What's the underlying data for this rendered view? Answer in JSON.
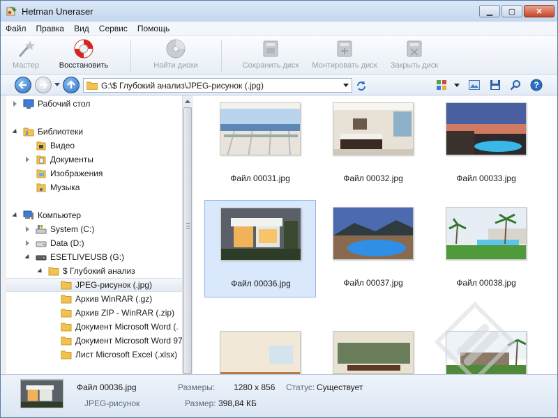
{
  "window": {
    "title": "Hetman Uneraser"
  },
  "menu": [
    "Файл",
    "Правка",
    "Вид",
    "Сервис",
    "Помощь"
  ],
  "toolbar": {
    "wizard": "Мастер",
    "restore": "Восстановить",
    "find_disks": "Найти диски",
    "save_disk": "Сохранить диск",
    "mount_disk": "Монтировать диск",
    "close_disk": "Закрыть диск"
  },
  "address": {
    "path": "G:\\$ Глубокий анализ\\JPEG-рисунок (.jpg)"
  },
  "tree": [
    {
      "label": "Рабочий стол",
      "icon": "desktop-icon"
    },
    {
      "label": "Библиотеки",
      "icon": "libraries-icon"
    },
    {
      "label": "Видео",
      "icon": "video-library-icon"
    },
    {
      "label": "Документы",
      "icon": "documents-library-icon"
    },
    {
      "label": "Изображения",
      "icon": "pictures-library-icon"
    },
    {
      "label": "Музыка",
      "icon": "music-library-icon"
    },
    {
      "label": "Компьютер",
      "icon": "computer-icon"
    },
    {
      "label": "System (C:)",
      "icon": "system-drive-icon"
    },
    {
      "label": "Data (D:)",
      "icon": "drive-icon"
    },
    {
      "label": "ESETLIVEUSB (G:)",
      "icon": "usb-drive-icon"
    },
    {
      "label": "$ Глубокий анализ",
      "icon": "folder-icon"
    },
    {
      "label": "JPEG-рисунок (.jpg)",
      "icon": "folder-icon"
    },
    {
      "label": "Архив WinRAR (.gz)",
      "icon": "folder-icon"
    },
    {
      "label": "Архив ZIP - WinRAR (.zip)",
      "icon": "folder-icon"
    },
    {
      "label": "Документ Microsoft Word (.",
      "icon": "folder-icon"
    },
    {
      "label": "Документ Microsoft Word 97",
      "icon": "folder-icon"
    },
    {
      "label": "Лист Microsoft Excel (.xlsx)",
      "icon": "folder-icon"
    }
  ],
  "files": [
    {
      "name": "Файл 00031.jpg",
      "scene": "balcony-view"
    },
    {
      "name": "Файл 00032.jpg",
      "scene": "bedroom"
    },
    {
      "name": "Файл 00033.jpg",
      "scene": "pool-dusk"
    },
    {
      "name": "Файл 00036.jpg",
      "scene": "modern-house"
    },
    {
      "name": "Файл 00037.jpg",
      "scene": "pool-night"
    },
    {
      "name": "Файл 00038.jpg",
      "scene": "pool-palms"
    },
    {
      "name": "",
      "scene": "living-room"
    },
    {
      "name": "",
      "scene": "dining-room"
    },
    {
      "name": "",
      "scene": "house-lawn"
    }
  ],
  "status": {
    "filename": "Файл 00036.jpg",
    "filetype": "JPEG-рисунок",
    "dims_label": "Размеры:",
    "dims_value": "1280 x 856",
    "size_label": "Размер:",
    "size_value": "398,84 КБ",
    "state_label": "Статус:",
    "state_value": "Существует"
  },
  "colors": {
    "accent": "#2c6fc0",
    "selection": "#d9e8fa",
    "folder": "#f2c14e"
  }
}
